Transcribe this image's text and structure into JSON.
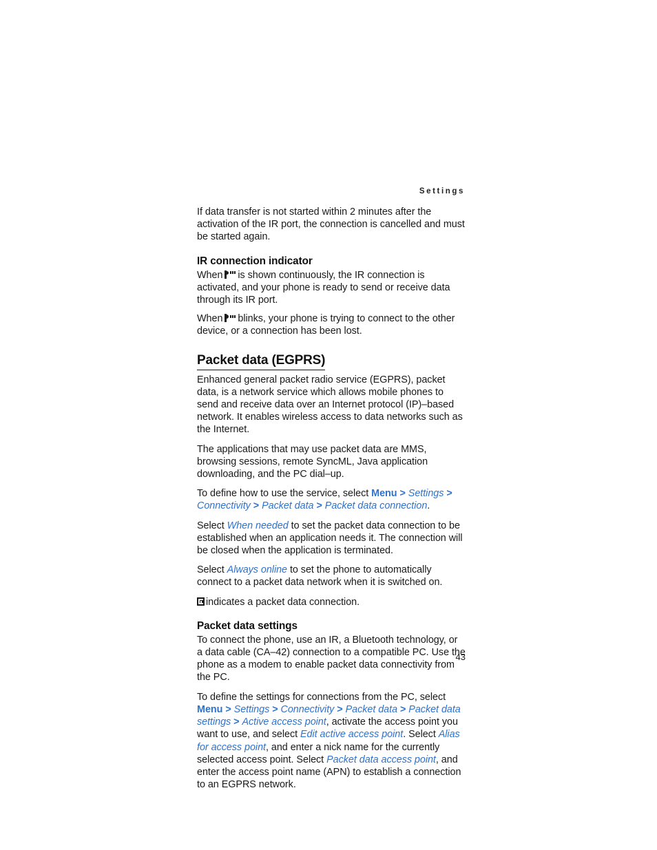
{
  "page": {
    "running_head": "Settings",
    "folio": "43",
    "accent_color": "#2f72cd",
    "text_color": "#1a1a1a"
  },
  "content": {
    "intro_paragraph": "If data transfer is not started within 2 minutes after the activation of the IR port, the connection is cancelled and must be started again.",
    "ir_heading": "IR connection indicator",
    "ir_para1_pre": "When",
    "ir_icon_name": "ir-indicator-icon",
    "ir_para1_post": "is shown continuously, the IR connection is activated, and your phone is ready to send or receive data through its IR port.",
    "ir_para2_pre": "When",
    "ir_para2_post": "blinks, your phone is trying to connect to the other device, or a connection has been lost.",
    "packet_heading": "Packet data (EGPRS)",
    "packet_para1": "Enhanced general packet radio service (EGPRS), packet data, is a network service which allows mobile phones to send and receive data over an Internet protocol (IP)–based network. It enables wireless access to data networks such as the Internet.",
    "packet_para2": "The applications that may use packet data are MMS, browsing sessions, remote SyncML, Java application downloading, and the PC dial–up.",
    "path1": {
      "lead": "To define how to use the service, select",
      "menu": "Menu",
      "sep": ">",
      "item1": "Settings",
      "item2": "Connectivity",
      "item3": "Packet data",
      "item4": "Packet data connection",
      "trail": "."
    },
    "when_needed": {
      "lead": "Select",
      "term": "When needed",
      "trail": "to set the packet data connection to be established when an application needs it. The connection will be closed when the application is terminated."
    },
    "always_online": {
      "lead": "Select",
      "term": "Always online",
      "trail": "to set the phone to automatically connect to a packet data network when it is switched on."
    },
    "g_indicator": {
      "icon_name": "gprs-indicator-icon",
      "text": "indicates a packet data connection."
    },
    "settings_heading": "Packet data settings",
    "settings_para1": "To connect the phone, use an IR, a Bluetooth technology, or a data cable (CA–42) connection to a compatible PC. Use the phone as a modem to enable packet data connectivity from the PC.",
    "path2": {
      "lead": "To define the settings for connections from the PC, select",
      "menu": "Menu",
      "sep": ">",
      "item1": "Settings",
      "item2": "Connectivity",
      "item3": "Packet data",
      "item4": "Packet data settings",
      "item5": "Active access point",
      "mid1": ", activate the access point you want to use, and select",
      "item6": "Edit active access point",
      "mid2": ". Select",
      "item7": "Alias for access point",
      "mid3": ", and enter a nick name for the currently selected access point. Select",
      "item8": "Packet data access point",
      "tail": ", and enter the access point name (APN) to establish a connection to an EGPRS network."
    }
  }
}
